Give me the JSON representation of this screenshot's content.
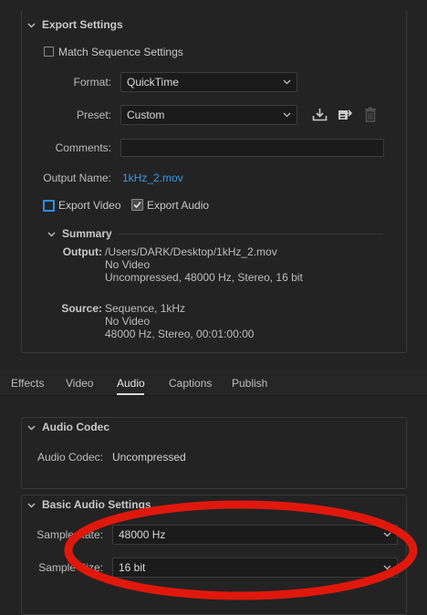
{
  "export_settings": {
    "title": "Export Settings",
    "match_sequence_label": "Match Sequence Settings",
    "format_label": "Format:",
    "format_value": "QuickTime",
    "preset_label": "Preset:",
    "preset_value": "Custom",
    "comments_label": "Comments:",
    "comments_value": "",
    "output_name_label": "Output Name:",
    "output_name_value": "1kHz_2.mov",
    "export_video_label": "Export Video",
    "export_audio_label": "Export Audio",
    "summary": {
      "title": "Summary",
      "output_key": "Output:",
      "output_lines": [
        "/Users/DARK/Desktop/1kHz_2.mov",
        "No Video",
        "Uncompressed, 48000 Hz, Stereo, 16 bit"
      ],
      "source_key": "Source:",
      "source_lines": [
        "Sequence, 1kHz",
        "No Video",
        "48000 Hz, Stereo, 00:01:00:00"
      ]
    }
  },
  "tabs": [
    {
      "label": "Effects"
    },
    {
      "label": "Video"
    },
    {
      "label": "Audio"
    },
    {
      "label": "Captions"
    },
    {
      "label": "Publish"
    }
  ],
  "active_tab": "Audio",
  "audio_codec": {
    "title": "Audio Codec",
    "codec_label": "Audio Codec:",
    "codec_value": "Uncompressed"
  },
  "basic_audio": {
    "title": "Basic Audio Settings",
    "sample_rate_label": "Sample Rate:",
    "sample_rate_value": "48000 Hz",
    "sample_size_label": "Sample Size:",
    "sample_size_value": "16 bit"
  },
  "colors": {
    "accent": "#2d8ceb",
    "link": "#3a9ae8",
    "annotation": "#e0180c"
  },
  "icons": [
    "chevron-down-icon",
    "save-preset-icon",
    "import-preset-icon",
    "delete-preset-icon",
    "checkmark-icon"
  ]
}
